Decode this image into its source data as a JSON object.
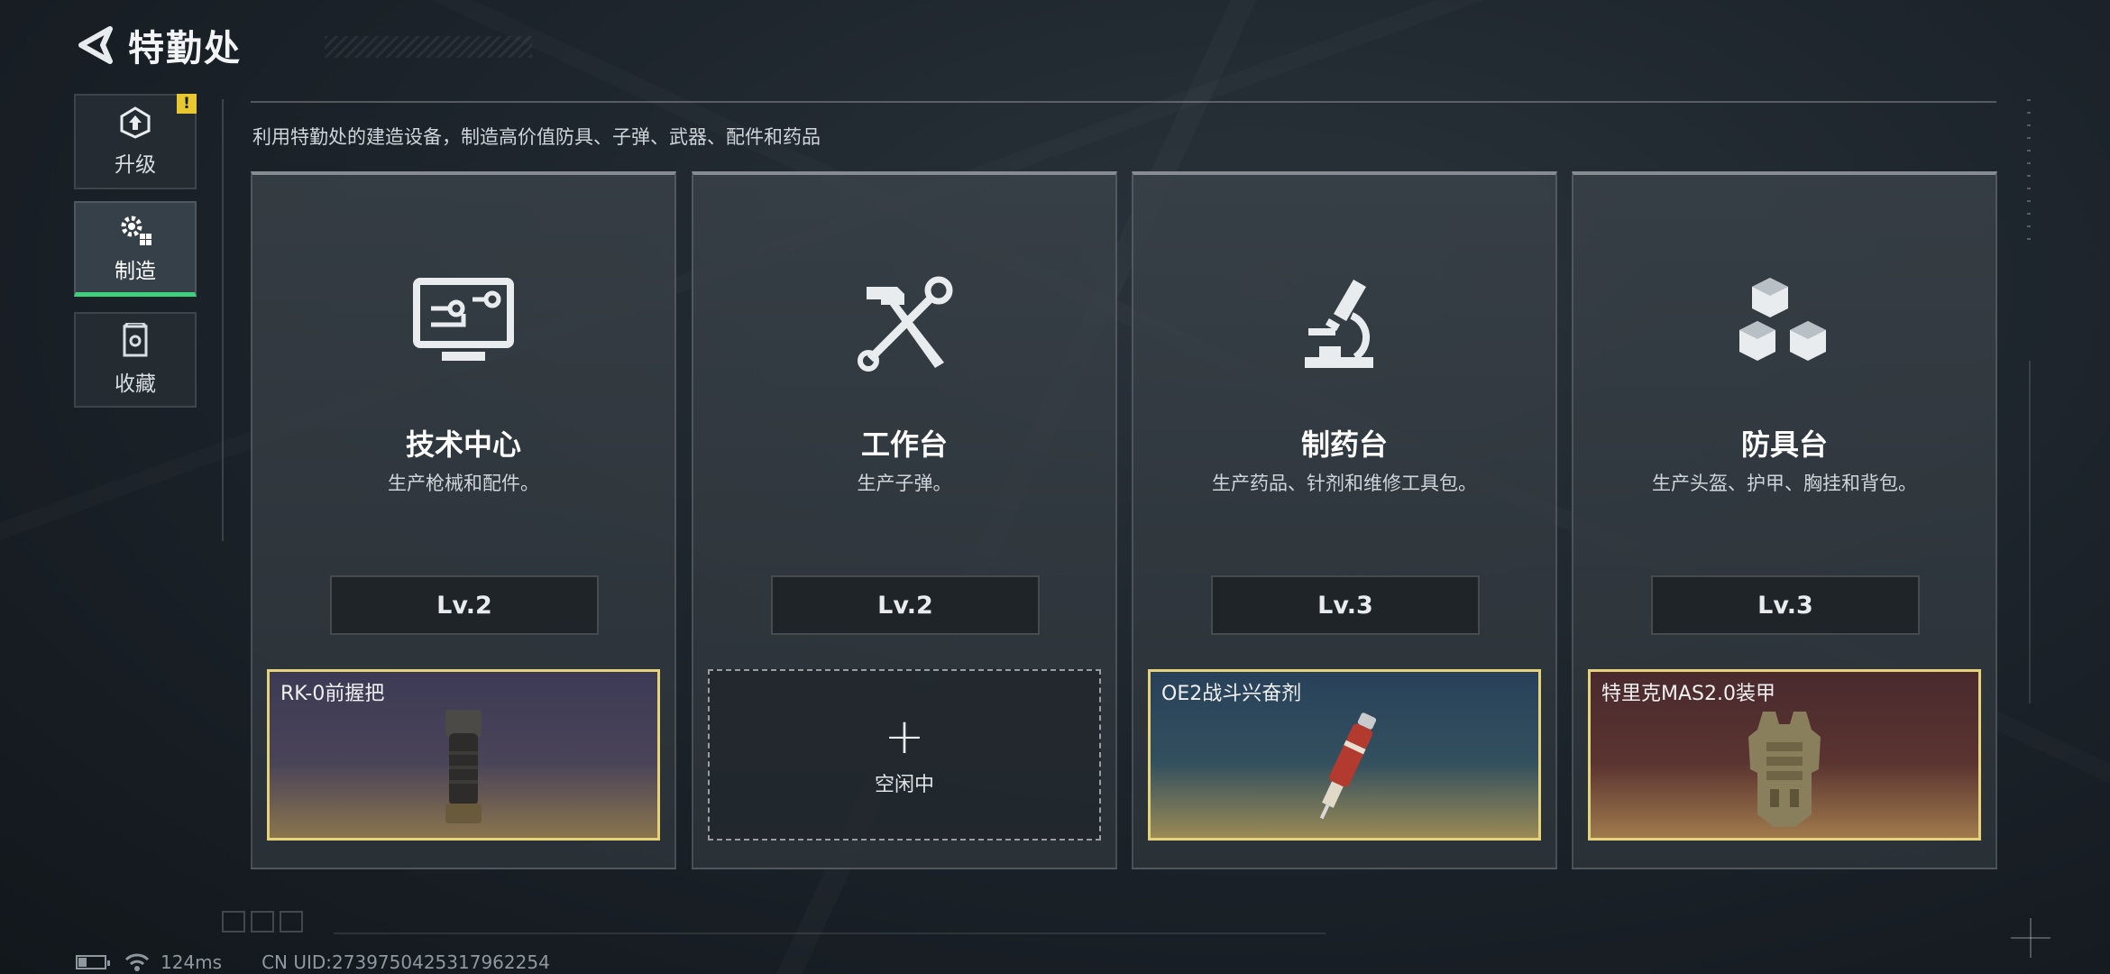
{
  "header": {
    "title": "特勤处",
    "back_icon": "back-arrow-icon"
  },
  "sidebar": {
    "items": [
      {
        "label": "升级",
        "icon": "upgrade-icon",
        "alert": "!",
        "active": false
      },
      {
        "label": "制造",
        "icon": "gears-icon",
        "active": true
      },
      {
        "label": "收藏",
        "icon": "collection-icon",
        "active": false
      }
    ]
  },
  "description": "利用特勤处的建造设备，制造高价值防具、子弹、武器、配件和药品",
  "stations": [
    {
      "name": "技术中心",
      "desc": "生产枪械和配件。",
      "level": "Lv.2",
      "icon": "monitor-circuit-icon",
      "slot": {
        "state": "producing",
        "item_name": "RK-0前握把",
        "item_icon": "foregrip-icon",
        "rarity_color": "#e5d27a"
      }
    },
    {
      "name": "工作台",
      "desc": "生产子弹。",
      "level": "Lv.2",
      "icon": "hammer-wrench-icon",
      "slot": {
        "state": "idle",
        "plus": "+",
        "idle_label": "空闲中"
      }
    },
    {
      "name": "制药台",
      "desc": "生产药品、针剂和维修工具包。",
      "level": "Lv.3",
      "icon": "microscope-icon",
      "slot": {
        "state": "producing",
        "item_name": "OE2战斗兴奋剂",
        "item_icon": "injector-icon",
        "rarity_color": "#e5d27a"
      }
    },
    {
      "name": "防具台",
      "desc": "生产头盔、护甲、胸挂和背包。",
      "level": "Lv.3",
      "icon": "cubes-icon",
      "slot": {
        "state": "producing",
        "item_name": "特里克MAS2.0装甲",
        "item_icon": "body-armor-icon",
        "rarity_color": "#e5d27a"
      }
    }
  ],
  "status": {
    "battery_level": 0.3,
    "ping": "124ms",
    "uid": "CN UID:2739750425317962254"
  },
  "colors": {
    "accent_green": "#3fd07e",
    "alert_yellow": "#e7c830",
    "gold_border": "#e5d27a"
  }
}
